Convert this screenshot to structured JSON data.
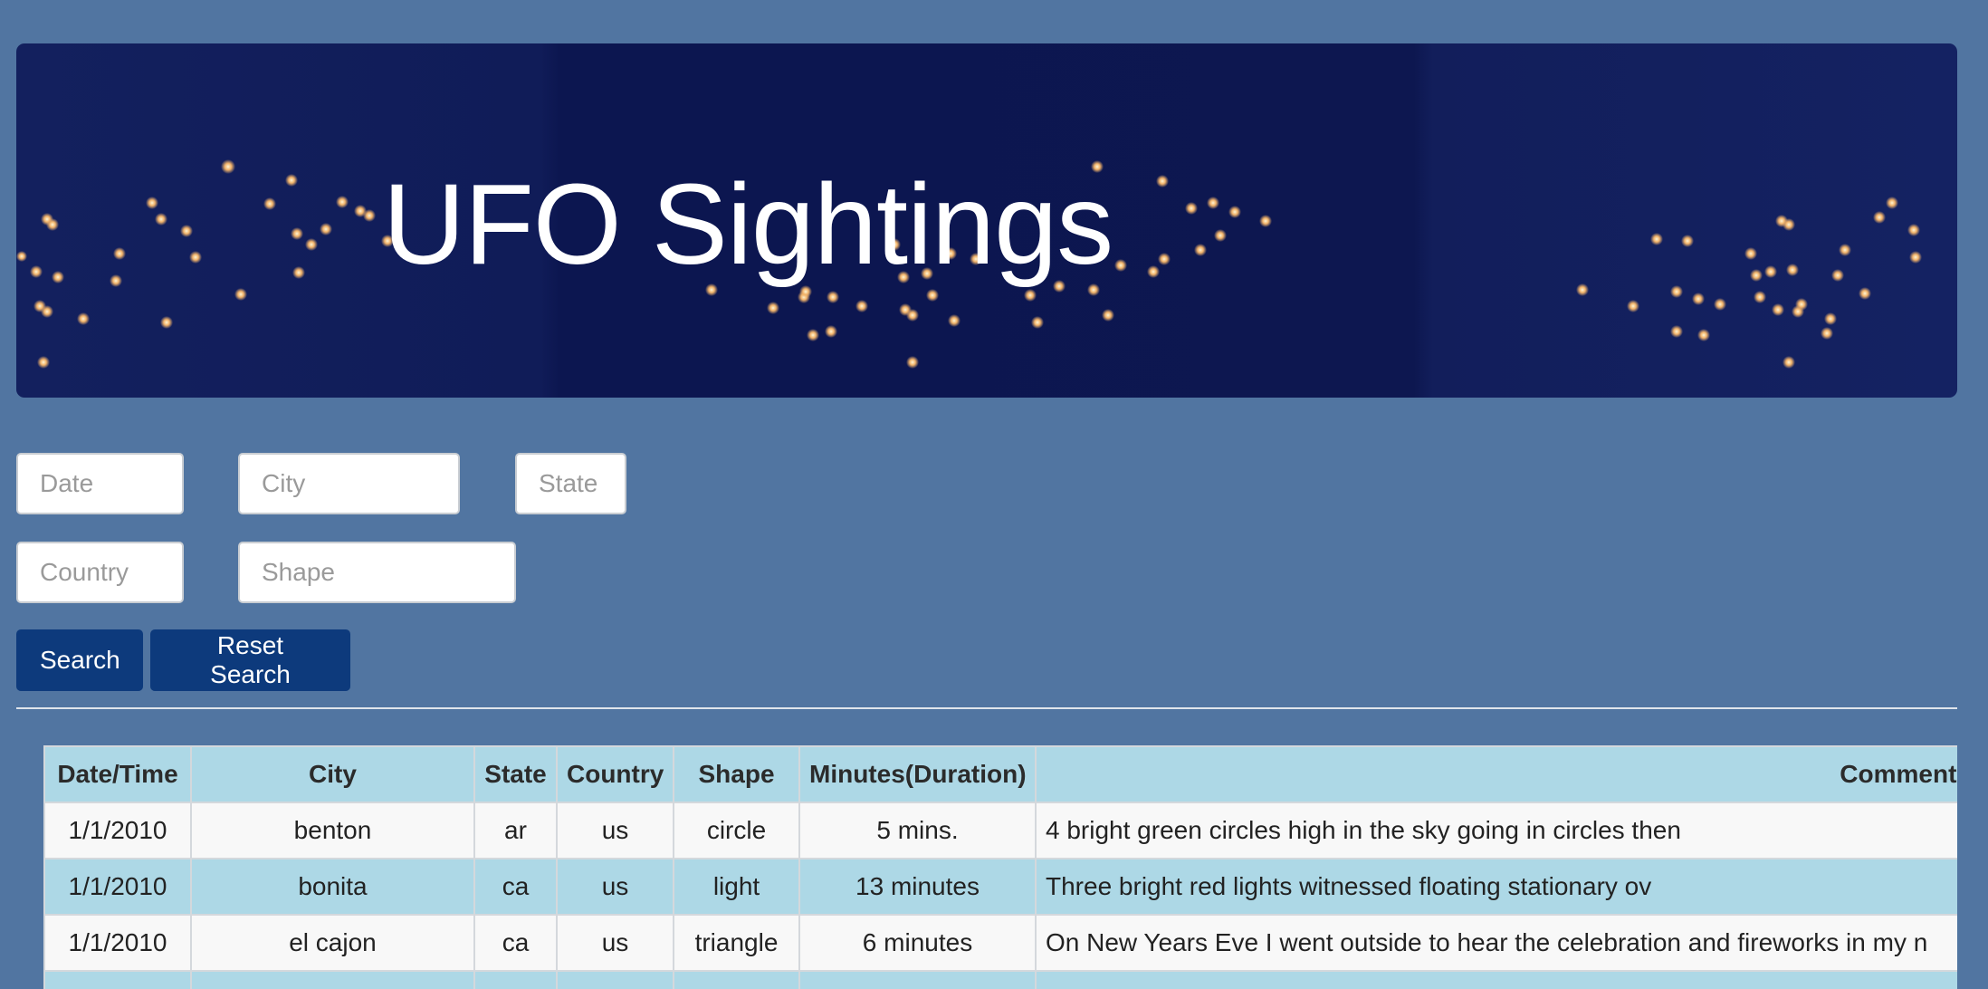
{
  "header": {
    "title": "UFO Sightings"
  },
  "filters": {
    "date_placeholder": "Date",
    "city_placeholder": "City",
    "state_placeholder": "State",
    "country_placeholder": "Country",
    "shape_placeholder": "Shape"
  },
  "buttons": {
    "search": "Search",
    "reset": "Reset Search"
  },
  "table": {
    "headers": [
      "Date/Time",
      "City",
      "State",
      "Country",
      "Shape",
      "Minutes(Duration)",
      "Comments"
    ],
    "rows": [
      [
        "1/1/2010",
        "benton",
        "ar",
        "us",
        "circle",
        "5 mins.",
        "4 bright green circles high in the sky going in circles then"
      ],
      [
        "1/1/2010",
        "bonita",
        "ca",
        "us",
        "light",
        "13 minutes",
        "Three bright red lights witnessed floating stationary ov"
      ],
      [
        "1/1/2010",
        "el cajon",
        "ca",
        "us",
        "triangle",
        "6 minutes",
        "On New Years Eve I went outside to hear the celebration and fireworks in my n"
      ],
      [
        "",
        "",
        "",
        "",
        "",
        "",
        ""
      ]
    ]
  },
  "colors": {
    "page_bg": "#5175a1",
    "banner_bg": "#101c58",
    "button_bg": "#0d3a7c",
    "table_header_bg": "#add8e6",
    "table_row_alt_bg": "#add8e6"
  }
}
